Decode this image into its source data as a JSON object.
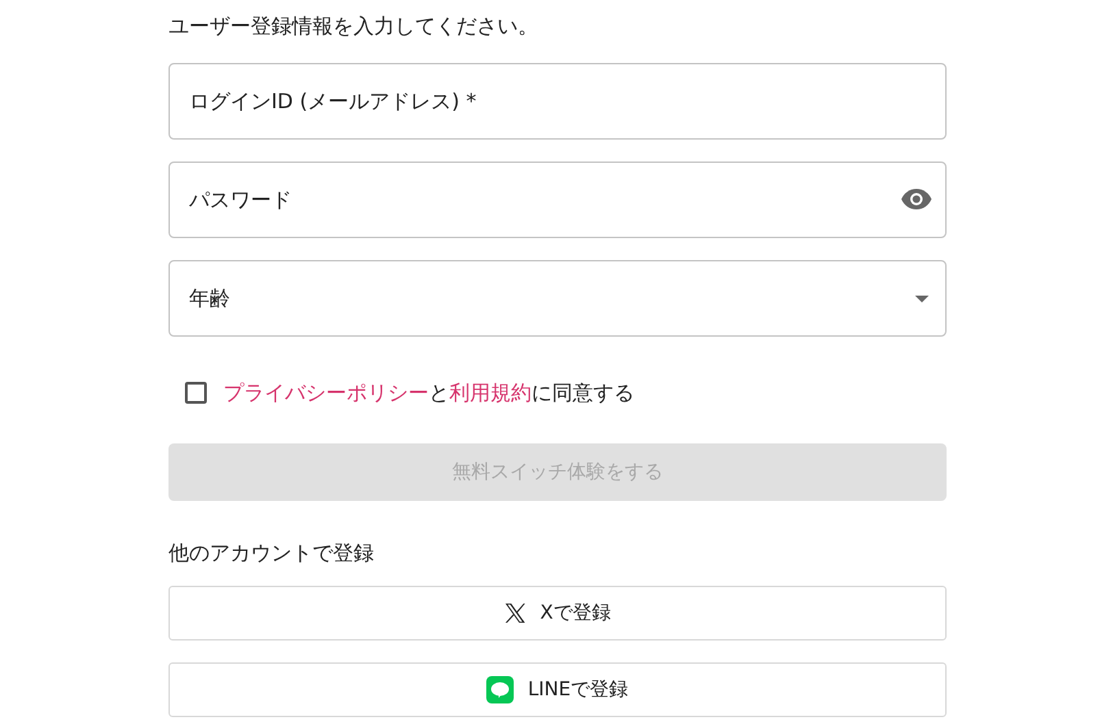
{
  "instruction": "ユーザー登録情報を入力してください。",
  "fields": [
    {
      "kind": "text",
      "placeholder": "ログインID (メールアドレス) *"
    },
    {
      "kind": "password",
      "placeholder": "パスワード"
    },
    {
      "kind": "select",
      "placeholder": "年齢"
    }
  ],
  "agreement": {
    "checked": false,
    "parts": [
      {
        "kind": "link",
        "text": "プライバシーポリシー"
      },
      {
        "kind": "plain",
        "text": "と"
      },
      {
        "kind": "link",
        "text": "利用規約"
      },
      {
        "kind": "plain",
        "text": "に同意する"
      }
    ]
  },
  "submit": {
    "label": "無料スイッチ体験をする",
    "disabled": true
  },
  "social_heading": "他のアカウントで登録",
  "social_buttons": [
    {
      "kind": "x",
      "label": "Xで登録"
    },
    {
      "kind": "line",
      "label": "LINEで登録"
    }
  ]
}
